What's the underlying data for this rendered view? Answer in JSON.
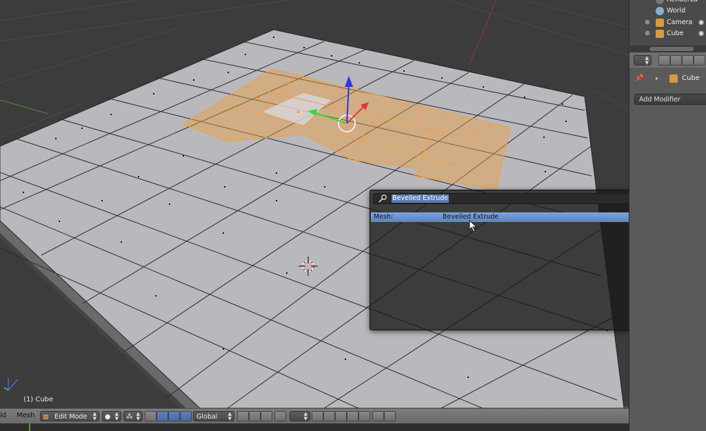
{
  "outliner": {
    "items": [
      {
        "label": "RenderLa",
        "icon": "render-layers-icon"
      },
      {
        "label": "World",
        "icon": "world-icon"
      },
      {
        "label": "Camera",
        "icon": "camera-icon"
      },
      {
        "label": "Cube",
        "icon": "mesh-icon"
      }
    ]
  },
  "properties": {
    "object_name": "Cube",
    "add_modifier_label": "Add Modifier"
  },
  "viewport": {
    "status_label": "(1) Cube"
  },
  "search_popup": {
    "query": "Bevelled Extrude",
    "results": [
      {
        "category": "Mesh:",
        "name": "Bevelled Extrude"
      }
    ]
  },
  "header": {
    "menu_left": "ld",
    "menu_mesh": "Mesh",
    "mode": "Edit Mode",
    "orientation": "Global"
  },
  "colors": {
    "selection": "#f0a040",
    "face": "#b8b8bc",
    "highlight": "#5a82c4"
  }
}
